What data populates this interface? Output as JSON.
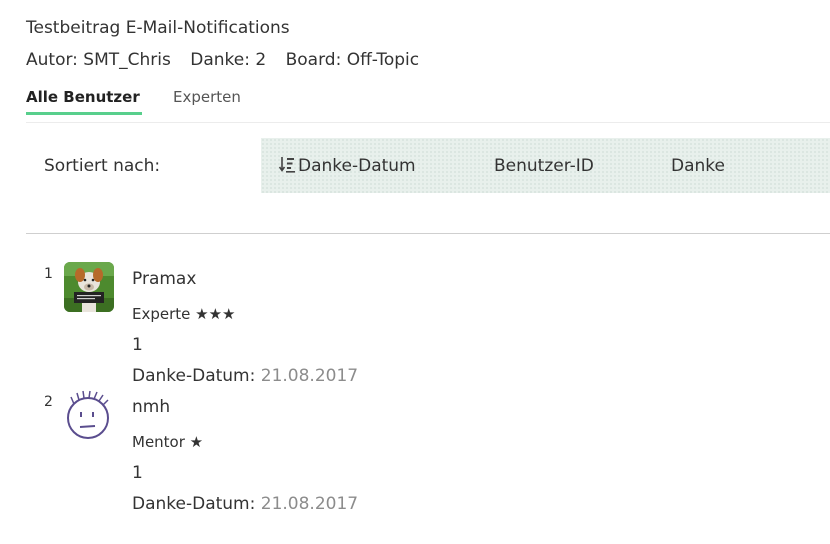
{
  "post": {
    "title": "Testbeitrag E-Mail-Notifications",
    "author": "Autor: SMT_Chris",
    "thanks": "Danke: 2",
    "board": "Board: Off-Topic"
  },
  "tabs": {
    "all_users": "Alle Benutzer",
    "experts": "Experten"
  },
  "sort": {
    "label": "Sortiert nach:",
    "options": [
      "Danke-Datum",
      "Benutzer-ID",
      "Danke"
    ],
    "active_icon": "sort-descending-icon"
  },
  "users": [
    {
      "rank": "1",
      "name": "Pramax",
      "role": "Experte ★★★",
      "count": "1",
      "date_label": "Danke-Datum:",
      "date": "21.08.2017",
      "avatar": "dog-photo-avatar"
    },
    {
      "rank": "2",
      "name": "nmh",
      "role": "Mentor ★",
      "count": "1",
      "date_label": "Danke-Datum:",
      "date": "21.08.2017",
      "avatar": "face-sketch-avatar"
    }
  ],
  "colors": {
    "accent_underline": "#58cf8c",
    "sort_bar_bg": "#e8f0ec",
    "date_value": "#8c8c8c"
  }
}
